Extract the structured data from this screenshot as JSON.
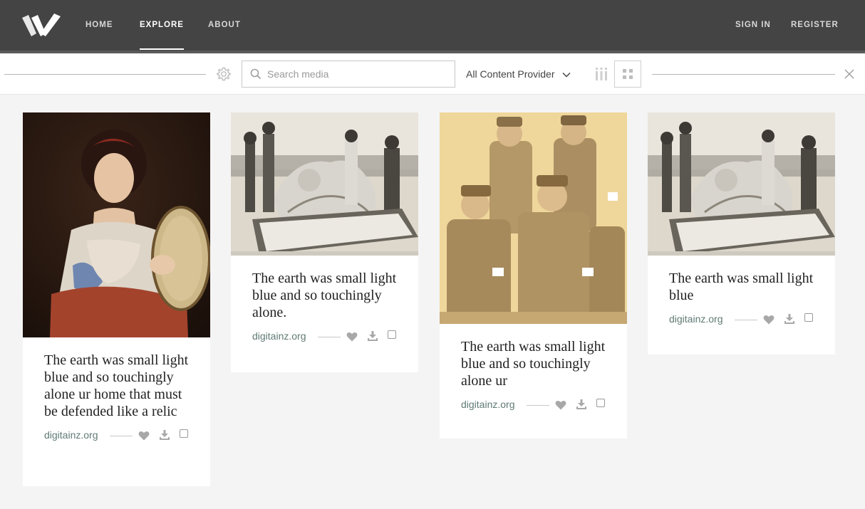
{
  "nav": {
    "items": [
      {
        "label": "HOME"
      },
      {
        "label": "EXPLORE"
      },
      {
        "label": "ABOUT"
      }
    ],
    "auth": {
      "sign_in": "SIGN IN",
      "register": "REGISTER"
    },
    "active": "EXPLORE"
  },
  "filter": {
    "search_placeholder": "Search media",
    "search_value": "",
    "provider": "All Content Provider"
  },
  "cards": [
    {
      "title": "The earth was small light blue and so touchingly alone ur home that must be defended like a relic",
      "source": "digitainz.org"
    },
    {
      "title": "The earth was small light blue and so touchingly alone.",
      "source": "digitainz.org"
    },
    {
      "title": "The earth was small light blue and so touchingly alone ur",
      "source": "digitainz.org"
    },
    {
      "title": "The earth was small light blue",
      "source": "digitainz.org"
    }
  ],
  "icons": {
    "logo": "logo-w",
    "settings": "gear-icon",
    "search": "search-icon",
    "dropdown": "chevron-down-icon",
    "column_view": "column-view-icon",
    "grid_view": "grid-view-icon",
    "close": "close-icon",
    "like": "heart-icon",
    "download": "download-icon"
  },
  "colors": {
    "nav_bg": "#444444",
    "page_bg": "#f4f4f4",
    "source_text": "#5f7a74",
    "icon_gray": "#a8a8a8"
  }
}
